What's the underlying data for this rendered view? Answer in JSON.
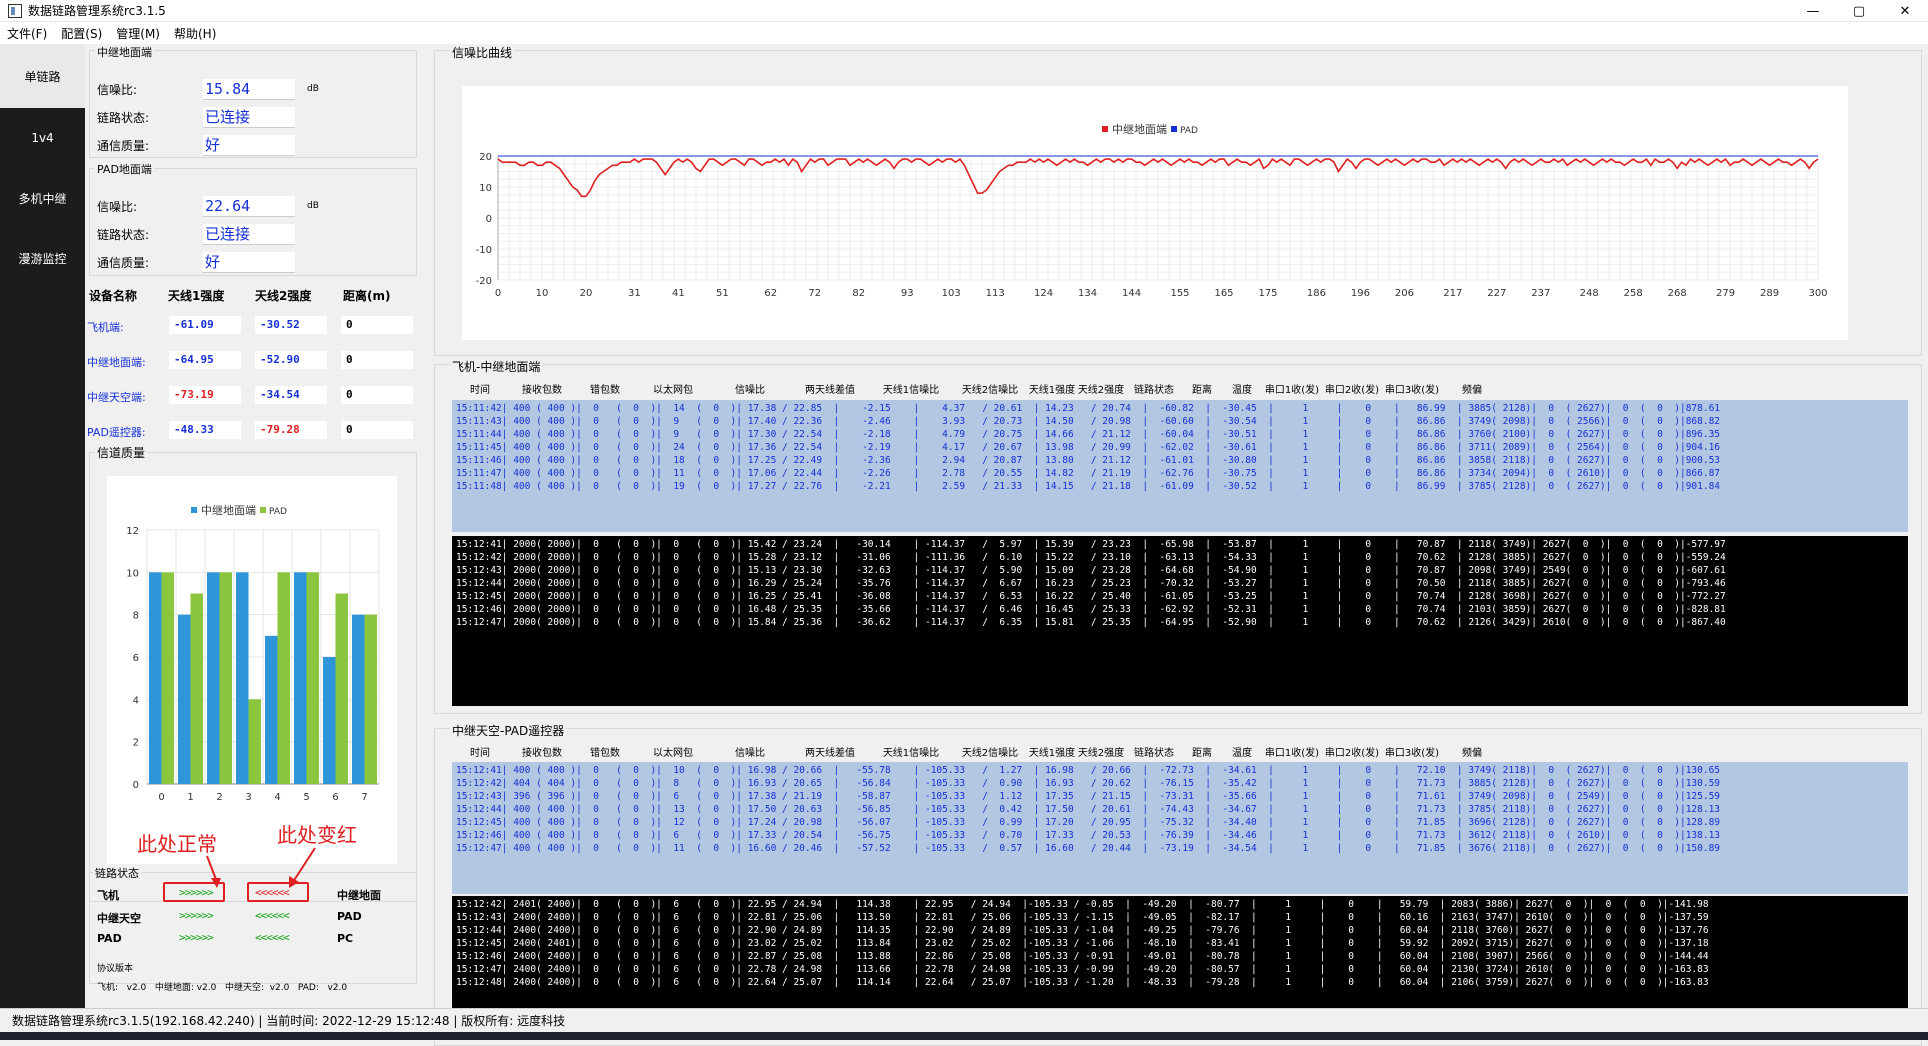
{
  "window": {
    "title": "数据链路管理系统rc3.1.5",
    "min": "—",
    "max": "▢",
    "close": "✕"
  },
  "menu": [
    "文件(F)",
    "配置(S)",
    "管理(M)",
    "帮助(H)"
  ],
  "sidenav": [
    "单链路",
    "1v4",
    "多机中继",
    "漫游监控"
  ],
  "relay_ground": {
    "group": "中继地面端",
    "snr_label": "信噪比:",
    "snr": "15.84",
    "unit": "dB",
    "link_label": "链路状态:",
    "link": "已连接",
    "quality_label": "通信质量:",
    "quality": "好"
  },
  "pad_ground": {
    "group": "PAD地面端",
    "snr_label": "信噪比:",
    "snr": "22.64",
    "unit": "dB",
    "link_label": "链路状态:",
    "link": "已连接",
    "quality_label": "通信质量:",
    "quality": "好"
  },
  "device_table": {
    "headers": [
      "设备名称",
      "天线1强度",
      "天线2强度",
      "距离(m)"
    ],
    "rows": [
      {
        "name": "飞机端:",
        "a1": "-61.09",
        "a2": "-30.52",
        "dist": "0",
        "a1_red": false,
        "a2_red": false
      },
      {
        "name": "中继地面端:",
        "a1": "-64.95",
        "a2": "-52.90",
        "dist": "0",
        "a1_red": false,
        "a2_red": false
      },
      {
        "name": "中继天空端:",
        "a1": "-73.19",
        "a2": "-34.54",
        "dist": "0",
        "a1_red": true,
        "a2_red": false
      },
      {
        "name": "PAD遥控器:",
        "a1": "-48.33",
        "a2": "-79.28",
        "dist": "0",
        "a1_red": false,
        "a2_red": true
      }
    ]
  },
  "channel_quality": {
    "group": "信道质量",
    "legend": [
      "中继地面端",
      "PAD"
    ]
  },
  "chart_data": [
    {
      "type": "bar",
      "title": "",
      "legend": [
        "中继地面端",
        "PAD"
      ],
      "categories": [
        "0",
        "1",
        "2",
        "3",
        "4",
        "5",
        "6",
        "7"
      ],
      "series": [
        {
          "name": "中继地面端",
          "color": "#2e95d8",
          "values": [
            10,
            8,
            10,
            10,
            7,
            10,
            6,
            8
          ]
        },
        {
          "name": "PAD",
          "color": "#8cc63e",
          "values": [
            10,
            9,
            10,
            4,
            10,
            10,
            9,
            8
          ]
        }
      ],
      "ylim": [
        0,
        12
      ],
      "yticks": [
        "0",
        "2",
        "4",
        "6",
        "8",
        "10",
        "12"
      ],
      "grid": true
    },
    {
      "type": "line",
      "title": "",
      "legend": [
        "中继地面端",
        "PAD"
      ],
      "xticks": [
        "0",
        "10",
        "20",
        "31",
        "41",
        "51",
        "62",
        "72",
        "82",
        "93",
        "103",
        "113",
        "124",
        "134",
        "144",
        "155",
        "165",
        "175",
        "186",
        "196",
        "206",
        "217",
        "227",
        "237",
        "248",
        "258",
        "268",
        "279",
        "289",
        "300"
      ],
      "yticks": [
        "20",
        "10",
        "0",
        "-10",
        "-20"
      ],
      "ylim": [
        -20,
        20
      ],
      "xlim": [
        0,
        300
      ],
      "grid": true,
      "series": [
        {
          "name": "中继地面端",
          "color": "#e02020",
          "values": [
            19,
            18,
            18,
            18,
            18,
            17,
            17,
            18,
            18,
            17,
            17,
            18,
            18,
            17,
            16,
            14,
            12,
            10,
            9,
            7,
            7,
            9,
            12,
            14,
            15,
            16,
            17,
            17,
            18,
            18,
            18,
            19,
            18,
            19,
            19,
            19,
            18,
            16,
            14,
            16,
            18,
            19,
            18,
            19,
            18,
            16,
            15,
            17,
            19,
            19,
            18,
            17,
            18,
            19,
            19,
            18,
            17,
            19,
            19,
            18,
            17,
            18,
            18,
            19,
            18,
            19,
            17,
            19,
            18,
            15,
            17,
            19,
            18,
            19,
            19,
            17,
            18,
            19,
            19,
            19,
            17,
            18,
            19,
            18,
            19,
            18,
            17,
            18,
            19,
            18,
            16,
            18,
            19,
            19,
            18,
            19,
            19,
            18,
            17,
            18,
            19,
            18,
            19,
            19,
            18,
            19,
            17,
            14,
            11,
            8,
            8,
            9,
            11,
            13,
            15,
            16,
            17,
            17,
            18,
            18,
            18,
            19,
            18,
            19,
            18,
            19,
            18,
            17,
            18,
            19,
            18,
            19,
            18,
            18,
            17,
            18,
            19,
            18,
            19,
            19,
            18,
            19,
            18,
            19,
            19,
            18,
            18,
            17,
            18,
            19,
            18,
            19,
            18,
            17,
            18,
            19,
            18,
            19,
            18,
            18,
            17,
            18,
            19,
            18,
            19,
            19,
            17,
            18,
            19,
            18,
            18,
            17,
            18,
            19,
            16,
            17,
            19,
            18,
            19,
            18,
            17,
            19,
            19,
            18,
            17,
            18,
            19,
            18,
            19,
            19,
            18,
            15,
            17,
            19,
            18,
            16,
            18,
            19,
            19,
            18,
            17,
            18,
            19,
            18,
            19,
            18,
            17,
            18,
            19,
            18,
            19,
            19,
            18,
            18,
            19,
            17,
            18,
            19,
            18,
            19,
            18,
            19,
            18,
            17,
            18,
            19,
            18,
            19,
            18,
            16,
            18,
            19,
            18,
            19,
            18,
            17,
            18,
            19,
            18,
            18,
            19,
            18,
            19,
            17,
            18,
            19,
            18,
            19,
            18,
            17,
            18,
            19,
            18,
            19,
            18,
            18,
            17,
            18,
            19,
            18,
            18,
            19,
            17,
            19,
            18,
            18,
            19,
            18,
            16,
            18,
            17,
            19,
            18,
            19,
            18,
            17,
            18,
            19,
            18,
            19,
            17,
            18,
            18,
            19,
            18,
            17,
            18,
            19,
            18,
            17,
            18,
            19,
            18,
            18,
            17,
            18,
            19,
            18,
            16,
            18,
            19
          ]
        },
        {
          "name": "PAD",
          "color": "#1530d6",
          "values": [
            20,
            20,
            20,
            20,
            20,
            20,
            20,
            20,
            20,
            20,
            20,
            20,
            20,
            20,
            20,
            20,
            20,
            20,
            20,
            20,
            20,
            20,
            20,
            20,
            20,
            20,
            20,
            20,
            20,
            20,
            20
          ]
        }
      ]
    }
  ],
  "link_status": {
    "group": "链路状态",
    "rows": [
      {
        "left": "飞机",
        "arrow1": ">>>>>>",
        "arrow2": "<<<<<<",
        "right": "中继地面"
      },
      {
        "left": "中继天空",
        "arrow1": ">>>>>>",
        "arrow2": "<<<<<<",
        "right": "PAD"
      },
      {
        "left": "PAD",
        "arrow1": ">>>>>>",
        "arrow2": "<<<<<<",
        "right": "PC"
      }
    ],
    "annotation_normal": "此处正常",
    "annotation_red": "此处变红"
  },
  "protocol": {
    "group": "协议版本",
    "text": "飞机:   v2.0   中继地面: v2.0   中继天空:  v2.0   PAD:   v2.0"
  },
  "snr_curve": {
    "group": "信噪比曲线"
  },
  "section1": {
    "title": "飞机-中继地面端",
    "headers": [
      "时间",
      "接收包数",
      "错包数",
      "以太网包",
      "信噪比",
      "两天线差值",
      "天线1信噪比",
      "天线2信噪比",
      "天线1强度",
      "天线2强度",
      "链路状态",
      "距离",
      "温度",
      "串口1收(发)",
      "串口2收(发)",
      "串口3收(发)",
      "频偏"
    ],
    "blue_rows": [
      "15:11:42| 400 ( 400 )|  0   (  0  )|  14  (  0  )| 17.38 / 22.85  |    -2.15    |    4.37   / 20.61  | 14.23   / 20.74  |  -60.82  |  -30.45  |     1     |    0    |   86.99  | 3885( 2128)|  0  ( 2627)|  0  (  0  )|878.61",
      "15:11:43| 400 ( 400 )|  0   (  0  )|  9   (  0  )| 17.40 / 22.36  |    -2.46    |    3.93   / 20.73  | 14.50   / 20.98  |  -60.60  |  -30.54  |     1     |    0    |   86.86  | 3749( 2098)|  0  ( 2566)|  0  (  0  )|868.82",
      "15:11:44| 400 ( 400 )|  0   (  0  )|  9   (  0  )| 17.30 / 22.54  |    -2.18    |    4.79   / 20.75  | 14.66   / 21.12  |  -60.04  |  -30.51  |     1     |    0    |   86.86  | 3760( 2100)|  0  ( 2627)|  0  (  0  )|896.35",
      "15:11:45| 400 ( 400 )|  0   (  0  )|  24  (  0  )| 17.36 / 22.54  |    -2.19    |    4.17   / 20.67  | 13.98   / 20.99  |  -62.02  |  -30.61  |     1     |    0    |   86.86  | 3711( 2089)|  0  ( 2564)|  0  (  0  )|904.16",
      "15:11:46| 400 ( 400 )|  0   (  0  )|  18  (  0  )| 17.25 / 22.49  |    -2.36    |    2.94   / 20.87  | 13.80   / 21.12  |  -61.01  |  -30.80  |     1     |    0    |   86.86  | 3858( 2118)|  0  ( 2627)|  0  (  0  )|900.53",
      "15:11:47| 400 ( 400 )|  0   (  0  )|  11  (  0  )| 17.06 / 22.44  |    -2.26    |    2.78   / 20.55  | 14.82   / 21.19  |  -62.76  |  -30.75  |     1     |    0    |   86.86  | 3734( 2094)|  0  ( 2610)|  0  (  0  )|866.87",
      "15:11:48| 400 ( 400 )|  0   (  0  )|  19  (  0  )| 17.27 / 22.76  |    -2.21    |    2.59   / 21.33  | 14.15   / 21.18  |  -61.09  |  -30.52  |     1     |    0    |   86.99  | 3785( 2128)|  0  ( 2627)|  0  (  0  )|901.84"
    ],
    "dark_rows": [
      "15:12:41| 2000( 2000)|  0   (  0  )|  0   (  0  )| 15.42 / 23.24  |   -30.14    | -114.37   /  5.97  | 15.39   / 23.23  |  -65.98  |  -53.87  |     1     |    0    |   70.87  | 2118( 3749)| 2627(  0  )|  0  (  0  )|-577.97",
      "15:12:42| 2000( 2000)|  0   (  0  )|  0   (  0  )| 15.28 / 23.12  |   -31.06    | -111.36   /  6.10  | 15.22   / 23.10  |  -63.13  |  -54.33  |     1     |    0    |   70.62  | 2128( 3885)| 2627(  0  )|  0  (  0  )|-559.24",
      "15:12:43| 2000( 2000)|  0   (  0  )|  0   (  0  )| 15.13 / 23.30  |   -32.63    | -114.37   /  5.90  | 15.09   / 23.28  |  -64.68  |  -54.90  |     1     |    0    |   70.87  | 2098( 3749)| 2549(  0  )|  0  (  0  )|-607.61",
      "15:12:44| 2000( 2000)|  0   (  0  )|  0   (  0  )| 16.29 / 25.24  |   -35.76    | -114.37   /  6.67  | 16.23   / 25.23  |  -70.32  |  -53.27  |     1     |    0    |   70.50  | 2118( 3885)| 2627(  0  )|  0  (  0  )|-793.46",
      "15:12:45| 2000( 2000)|  0   (  0  )|  0   (  0  )| 16.25 / 25.41  |   -36.08    | -114.37   /  6.53  | 16.22   / 25.40  |  -61.05  |  -53.25  |     1     |    0    |   70.74  | 2128( 3698)| 2627(  0  )|  0  (  0  )|-772.27",
      "15:12:46| 2000( 2000)|  0   (  0  )|  0   (  0  )| 16.48 / 25.35  |   -35.66    | -114.37   /  6.46  | 16.45   / 25.33  |  -62.92  |  -52.31  |     1     |    0    |   70.74  | 2103( 3859)| 2627(  0  )|  0  (  0  )|-828.81",
      "15:12:47| 2000( 2000)|  0   (  0  )|  0   (  0  )| 15.84 / 25.36  |   -36.62    | -114.37   /  6.35  | 15.81   / 25.35  |  -64.95  |  -52.90  |     1     |    0    |   70.62  | 2126( 3429)| 2610(  0  )|  0  (  0  )|-867.40"
    ]
  },
  "section2": {
    "title": "中继天空-PAD遥控器",
    "headers": [
      "时间",
      "接收包数",
      "错包数",
      "以太网包",
      "信噪比",
      "两天线差值",
      "天线1信噪比",
      "天线2信噪比",
      "天线1强度",
      "天线2强度",
      "链路状态",
      "距离",
      "温度",
      "串口1收(发)",
      "串口2收(发)",
      "串口3收(发)",
      "频偏"
    ],
    "blue_rows": [
      "15:12:41| 400 ( 400 )|  0   (  0  )|  10  (  0  )| 16.98 / 20.66  |   -55.78    | -105.33   /  1.27  | 16.98   / 20.66  |  -72.73  |  -34.61  |     1     |    0    |   72.10  | 3749( 2118)|  0  ( 2627)|  0  (  0  )|130.65",
      "15:12:42| 404 ( 404 )|  0   (  0  )|  8   (  0  )| 16.93 / 20.65  |   -56.84    | -105.33   /  0.90  | 16.93   / 20.62  |  -76.15  |  -35.42  |     1     |    0    |   71.73  | 3885( 2128)|  0  ( 2627)|  0  (  0  )|130.59",
      "15:12:43| 396 ( 396 )|  0   (  0  )|  6   (  0  )| 17.38 / 21.19  |   -58.87    | -105.33   /  1.12  | 17.35   / 21.15  |  -73.31  |  -35.66  |     1     |    0    |   71.61  | 3749( 2098)|  0  ( 2549)|  0  (  0  )|125.59",
      "15:12:44| 400 ( 400 )|  0   (  0  )|  13  (  0  )| 17.50 / 20.63  |   -56.85    | -105.33   /  0.42  | 17.50   / 20.61  |  -74.43  |  -34.67  |     1     |    0    |   71.73  | 3785( 2118)|  0  ( 2627)|  0  (  0  )|128.13",
      "15:12:45| 400 ( 400 )|  0   (  0  )|  12  (  0  )| 17.24 / 20.98  |   -56.07    | -105.33   /  0.99  | 17.20   / 20.95  |  -75.32  |  -34.40  |     1     |    0    |   71.85  | 3696( 2128)|  0  ( 2627)|  0  (  0  )|128.89",
      "15:12:46| 400 ( 400 )|  0   (  0  )|  6   (  0  )| 17.33 / 20.54  |   -56.75    | -105.33   /  0.70  | 17.33   / 20.53  |  -76.39  |  -34.46  |     1     |    0    |   71.73  | 3612( 2118)|  0  ( 2610)|  0  (  0  )|138.13",
      "15:12:47| 400 ( 400 )|  0   (  0  )|  11  (  0  )| 16.60 / 20.46  |   -57.52    | -105.33   /  0.57  | 16.60   / 20.44  |  -73.19  |  -34.54  |     1     |    0    |   71.85  | 3676( 2118)|  0  ( 2627)|  0  (  0  )|150.89"
    ],
    "dark_rows": [
      "15:12:42| 2401( 2400)|  0   (  0  )|  6   (  0  )| 22.95 / 24.94  |   114.38    | 22.95   / 24.94  |-105.33 / -0.85  |  -49.20  |  -80.77  |     1     |    0    |   59.79  | 2083( 3886)| 2627(  0  )|  0  (  0  )|-141.98",
      "15:12:43| 2400( 2400)|  0   (  0  )|  6   (  0  )| 22.81 / 25.06  |   113.50    | 22.81   / 25.06  |-105.33 / -1.15  |  -49.05  |  -82.17  |     1     |    0    |   60.16  | 2163( 3747)| 2610(  0  )|  0  (  0  )|-137.59",
      "15:12:44| 2400( 2400)|  0   (  0  )|  6   (  0  )| 22.90 / 24.89  |   114.35    | 22.90   / 24.89  |-105.33 / -1.04  |  -49.25  |  -79.76  |     1     |    0    |   60.04  | 2118( 3760)| 2627(  0  )|  0  (  0  )|-137.76",
      "15:12:45| 2400( 2401)|  0   (  0  )|  6   (  0  )| 23.02 / 25.02  |   113.84    | 23.02   / 25.02  |-105.33 / -1.06  |  -48.10  |  -83.41  |     1     |    0    |   59.92  | 2092( 3715)| 2627(  0  )|  0  (  0  )|-137.18",
      "15:12:46| 2400( 2400)|  0   (  0  )|  6   (  0  )| 22.87 / 25.08  |   113.88    | 22.86   / 25.08  |-105.33 / -0.91  |  -49.01  |  -80.78  |     1     |    0    |   60.04  | 2108( 3907)| 2566(  0  )|  0  (  0  )|-144.44",
      "15:12:47| 2400( 2400)|  0   (  0  )|  6   (  0  )| 22.78 / 24.98  |   113.66    | 22.78   / 24.98  |-105.33 / -0.99  |  -49.20  |  -80.57  |     1     |    0    |   60.04  | 2130( 3724)| 2610(  0  )|  0  (  0  )|-163.83",
      "15:12:48| 2400( 2400)|  0   (  0  )|  6   (  0  )| 22.64 / 25.07  |   114.14    | 22.64   / 25.07  |-105.33 / -1.20  |  -48.33  |  -79.28  |     1     |    0    |   60.04  | 2106( 3759)| 2627(  0  )|  0  (  0  )|-163.83"
    ]
  },
  "statusbar": "数据链路管理系统rc3.1.5(192.168.42.240) | 当前时间:  2022-12-29 15:12:48  | 版权所有: 远度科技"
}
